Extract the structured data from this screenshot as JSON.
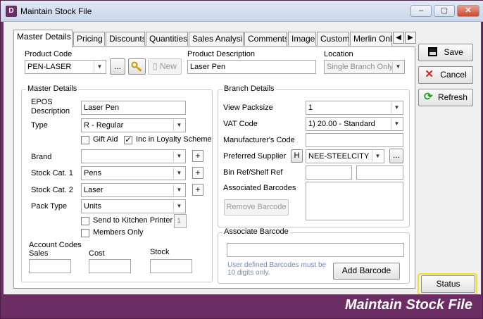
{
  "window": {
    "app_icon": "D",
    "title": "Maintain Stock File",
    "footer_title": "Maintain Stock File"
  },
  "tabs": [
    {
      "label": "Master Details"
    },
    {
      "label": "Pricing"
    },
    {
      "label": "Discounts"
    },
    {
      "label": "Quantities"
    },
    {
      "label": "Sales Analysis"
    },
    {
      "label": "Comments"
    },
    {
      "label": "Image"
    },
    {
      "label": "Custom"
    },
    {
      "label": "Merlin Onlin"
    }
  ],
  "header": {
    "product_code_label": "Product Code",
    "product_code": "PEN-LASER",
    "ellipsis": "...",
    "new_label": "New",
    "product_description_label": "Product Description",
    "product_description": "Laser Pen",
    "location_label": "Location",
    "location": "Single Branch Only"
  },
  "master": {
    "group_label": "Master Details",
    "epos_label_1": "EPOS",
    "epos_label_2": "Description",
    "epos_value": "Laser Pen",
    "type_label": "Type",
    "type_value": "R - Regular",
    "gift_aid_label": "Gift Aid",
    "gift_aid_checked": false,
    "loyalty_label": "Inc in Loyalty Scheme",
    "loyalty_checked": true,
    "brand_label": "Brand",
    "brand_value": "",
    "stock_cat1_label": "Stock Cat. 1",
    "stock_cat1_value": "Pens",
    "stock_cat2_label": "Stock Cat. 2",
    "stock_cat2_value": "Laser",
    "pack_type_label": "Pack Type",
    "pack_type_value": "Units",
    "kitchen_label": "Send to Kitchen Printer",
    "kitchen_checked": false,
    "kitchen_value": "1",
    "members_label": "Members Only",
    "members_checked": false,
    "account_codes_label": "Account Codes",
    "sales_label": "Sales",
    "cost_label": "Cost",
    "stock_label": "Stock",
    "sales_value": "",
    "cost_value": "",
    "stock_value": ""
  },
  "branch": {
    "group_label": "Branch Details",
    "view_packsize_label": "View Packsize",
    "view_packsize_value": "1",
    "vat_code_label": "VAT Code",
    "vat_code_value": "1) 20.00 - Standard",
    "manufacturer_code_label": "Manufacturer's Code",
    "manufacturer_code_value": "",
    "preferred_supplier_label": "Preferred Supplier",
    "h_button": "H",
    "preferred_supplier_value": "NEE-STEELCITY",
    "supplier_ellipsis": "...",
    "bin_ref_label": "Bin Ref/Shelf Ref",
    "associated_barcodes_label": "Associated Barcodes",
    "remove_barcode_label": "Remove Barcode"
  },
  "associate": {
    "group_label": "Associate Barcode",
    "barcode_value": "",
    "hint_line1": "User defined Barcodes must be",
    "hint_line2": "10 digits only.",
    "add_barcode_label": "Add Barcode"
  },
  "actions": {
    "save": "Save",
    "cancel": "Cancel",
    "refresh": "Refresh",
    "status": "Status"
  },
  "colors": {
    "window_frame": "#6b2d63",
    "highlight": "#f3e21c",
    "hint_text": "#6d8cbf"
  }
}
